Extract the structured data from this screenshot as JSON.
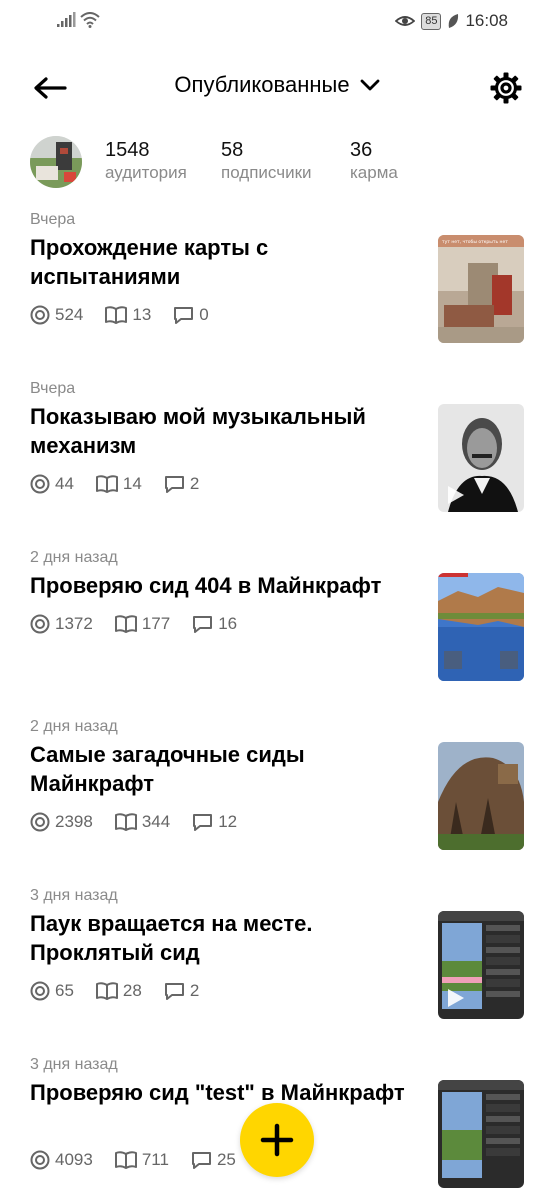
{
  "status_bar": {
    "battery": "85",
    "time": "16:08"
  },
  "header": {
    "title": "Опубликованные"
  },
  "profile": {
    "stats": [
      {
        "value": "1548",
        "label": "аудитория"
      },
      {
        "value": "58",
        "label": "подписчики"
      },
      {
        "value": "36",
        "label": "карма"
      }
    ]
  },
  "feed": [
    {
      "date": "Вчера",
      "title": "Прохождение карты с испытаниями",
      "views": "524",
      "reads": "13",
      "comments": "0",
      "thumb_caption": "тут нет, чтобы открыть нет"
    },
    {
      "date": "Вчера",
      "title": "Показываю мой музыкальный механизм",
      "views": "44",
      "reads": "14",
      "comments": "2"
    },
    {
      "date": "2 дня назад",
      "title": "Проверяю сид 404 в Майнкрафт",
      "views": "1372",
      "reads": "177",
      "comments": "16"
    },
    {
      "date": "2 дня назад",
      "title": "Самые загадочные сиды Майнкрафт",
      "views": "2398",
      "reads": "344",
      "comments": "12"
    },
    {
      "date": "3 дня назад",
      "title": "Паук вращается на месте. Проклятый сид",
      "views": "65",
      "reads": "28",
      "comments": "2"
    },
    {
      "date": "3 дня назад",
      "title": "Проверяю сид \"test\" в Майнкрафт",
      "views": "4093",
      "reads": "711",
      "comments": "25"
    }
  ],
  "icons": {
    "back": "arrow-left-icon",
    "dropdown": "chevron-down-icon",
    "settings": "gear-icon",
    "views": "eye-icon",
    "reads": "book-icon",
    "comments": "comment-icon",
    "add": "plus-icon"
  },
  "colors": {
    "fab": "#ffd600",
    "muted": "#8a8a8a"
  }
}
